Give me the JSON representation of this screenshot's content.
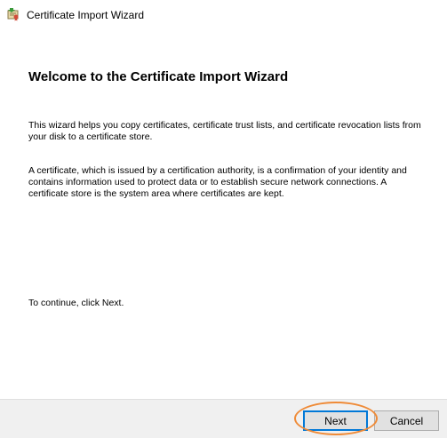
{
  "window": {
    "title": "Certificate Import Wizard",
    "icon": "certificate-wizard-icon"
  },
  "main": {
    "heading": "Welcome to the Certificate Import Wizard",
    "paragraph1": "This wizard helps you copy certificates, certificate trust lists, and certificate revocation lists from your disk to a certificate store.",
    "paragraph2": "A certificate, which is issued by a certification authority, is a confirmation of your identity and contains information used to protect data or to establish secure network connections. A certificate store is the system area where certificates are kept.",
    "continue_text": "To continue, click Next."
  },
  "footer": {
    "next_label": "Next",
    "cancel_label": "Cancel"
  },
  "colors": {
    "accent": "#0078d7",
    "highlight": "#ef8a36",
    "footer_bg": "#f0f0f0"
  }
}
